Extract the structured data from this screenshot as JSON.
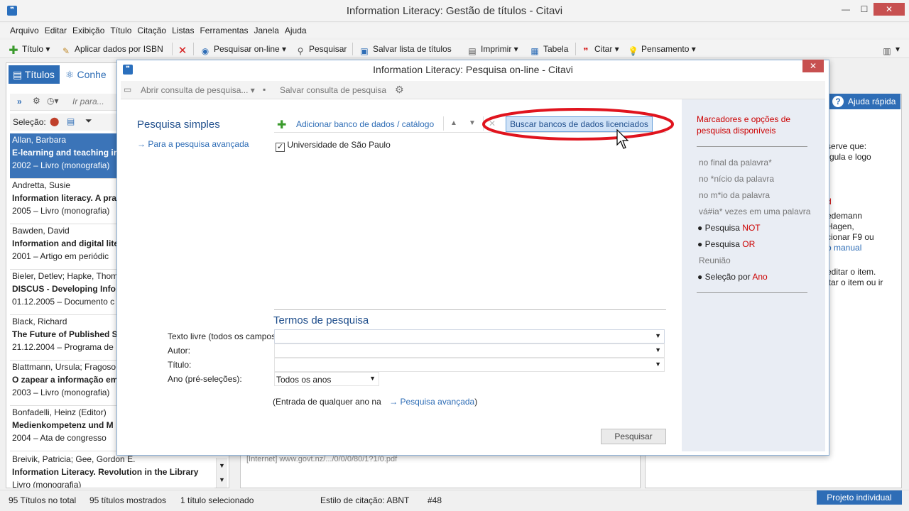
{
  "window": {
    "title": "Information Literacy: Gestão de títulos - Citavi",
    "minimize": "—",
    "maximize": "☐",
    "close": "✕"
  },
  "menu": [
    "Arquivo",
    "Editar",
    "Exibição",
    "Título",
    "Citação",
    "Listas",
    "Ferramentas",
    "Janela",
    "Ajuda"
  ],
  "toolbar": {
    "titulo": "Título",
    "isbn": "Aplicar dados por ISBN",
    "pesquisar_online": "Pesquisar on-line",
    "pesquisar": "Pesquisar",
    "salvar_lista": "Salvar lista de títulos",
    "imprimir": "Imprimir",
    "tabela": "Tabela",
    "citar": "Citar",
    "pensamento": "Pensamento"
  },
  "left": {
    "tab_titulos": "Títulos",
    "tab_conhecimento": "Conhe",
    "goto_placeholder": "Ir para...",
    "selecao_label": "Seleção:",
    "items": [
      {
        "author": "Allan, Barbara",
        "title": "E-learning and teaching in",
        "meta": "2002 – Livro (monografia)"
      },
      {
        "author": "Andretta, Susie",
        "title": "Information literacy. A pra",
        "meta": "2005 – Livro (monografia)"
      },
      {
        "author": "Bawden, David",
        "title": "Information and digital lite",
        "meta": "2001 – Artigo em periódic"
      },
      {
        "author": "Bieler, Detlev; Hapke, Thom",
        "title": "DISCUS - Developing Info",
        "meta": "01.12.2005 – Documento c"
      },
      {
        "author": "Black, Richard",
        "title": "The Future of Published Sc",
        "meta": "21.12.2004 – Programa de"
      },
      {
        "author": "Blattmann, Ursula; Fragoso,",
        "title": "O zapear a informação em",
        "meta": "2003 – Livro (monografia)"
      },
      {
        "author": "Bonfadelli, Heinz (Editor)",
        "title": "Medienkompetenz und M",
        "meta": "2004 – Ata de congresso"
      },
      {
        "author": "Breivik, Patricia; Gee, Gordon E.",
        "title": "Information Literacy. Revolution in the Library",
        "meta": "Livro (monografia)"
      }
    ]
  },
  "right": {
    "help_label": "Ajuda rápida",
    "lines": [
      "serve que:",
      "rgula e logo",
      "",
      "d",
      "edemann",
      "Hagen,",
      "cionar F9 ou",
      "o manual",
      "",
      "editar o item.",
      "itar o item ou ir"
    ]
  },
  "bottom_strip": "[Internet]           www.govt.nz/.../0/0/0/80/1?1/0.pdf",
  "status": {
    "total": "95 Títulos no total",
    "mostrados": "95 títulos mostrados",
    "selecionado": "1 título selecionado",
    "estilo": "Estilo de citação: ABNT",
    "numero": "#48",
    "projeto": "Projeto individual"
  },
  "dialog": {
    "title": "Information Literacy: Pesquisa on-line - Citavi",
    "toolbar": {
      "abrir": "Abrir consulta de pesquisa...",
      "salvar": "Salvar consulta de pesquisa"
    },
    "pesquisa_simples": "Pesquisa simples",
    "pesquisa_avancada_link": "Para a pesquisa avançada",
    "adicionar_banco": "Adicionar banco de dados / catálogo",
    "buscar_bancos": "Buscar bancos de dados licenciados",
    "databases": [
      {
        "name": "Universidade de São Paulo",
        "checked": true
      }
    ],
    "termos_header": "Termos de pesquisa",
    "fields": {
      "texto_livre": "Texto livre (todos os campos",
      "autor": "Autor:",
      "titulo": "Título:",
      "ano": "Ano (pré-seleções):",
      "ano_value": "Todos os anos"
    },
    "entrada_note_prefix": "(Entrada de qualquer ano na",
    "entrada_note_link": "Pesquisa avançada",
    "entrada_note_suffix": ")",
    "pesquisar_button": "Pesquisar",
    "sidebar": {
      "header": "Marcadores e opções de pesquisa disponíveis",
      "items": [
        {
          "text": "no final da palavra*",
          "style": "gray"
        },
        {
          "text": "no *nício da palavra",
          "style": "gray"
        },
        {
          "text": "no m*io da palavra",
          "style": "gray"
        },
        {
          "text": "vá#ia* vezes em uma palavra",
          "style": "gray"
        },
        {
          "prefix": "Pesquisa ",
          "highlight": "NOT",
          "style": "bullet"
        },
        {
          "prefix": "Pesquisa ",
          "highlight": "OR",
          "style": "bullet"
        },
        {
          "text": "Reunião",
          "style": "gray"
        },
        {
          "prefix": "Seleção por ",
          "highlight": "Ano",
          "style": "bullet"
        }
      ]
    }
  },
  "colors": {
    "accent": "#2e6db6",
    "selection": "#3b74b8",
    "annotation_red": "#e0141e"
  }
}
